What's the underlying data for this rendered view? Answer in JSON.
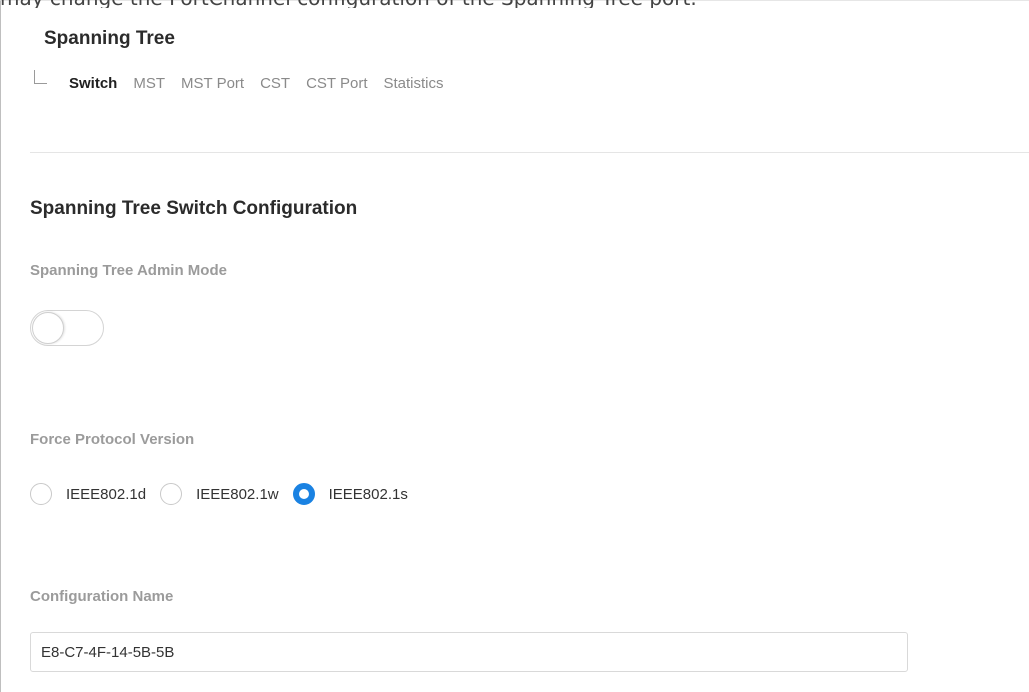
{
  "page": {
    "title": "Spanning Tree",
    "partial_top_text": "may change the PortChannel configuration of the Spanning Tree port."
  },
  "subnav": {
    "tabs": [
      {
        "label": "Switch",
        "active": true
      },
      {
        "label": "MST",
        "active": false
      },
      {
        "label": "MST Port",
        "active": false
      },
      {
        "label": "CST",
        "active": false
      },
      {
        "label": "CST Port",
        "active": false
      },
      {
        "label": "Statistics",
        "active": false
      }
    ]
  },
  "section": {
    "title": "Spanning Tree Switch Configuration"
  },
  "admin_mode": {
    "label": "Spanning Tree Admin Mode",
    "enabled": false
  },
  "force_protocol": {
    "label": "Force Protocol Version",
    "options": [
      {
        "label": "IEEE802.1d",
        "checked": false
      },
      {
        "label": "IEEE802.1w",
        "checked": false
      },
      {
        "label": "IEEE802.1s",
        "checked": true
      }
    ],
    "accent_color": "#1a82e2"
  },
  "config_name": {
    "label": "Configuration Name",
    "value": "E8-C7-4F-14-5B-5B"
  }
}
